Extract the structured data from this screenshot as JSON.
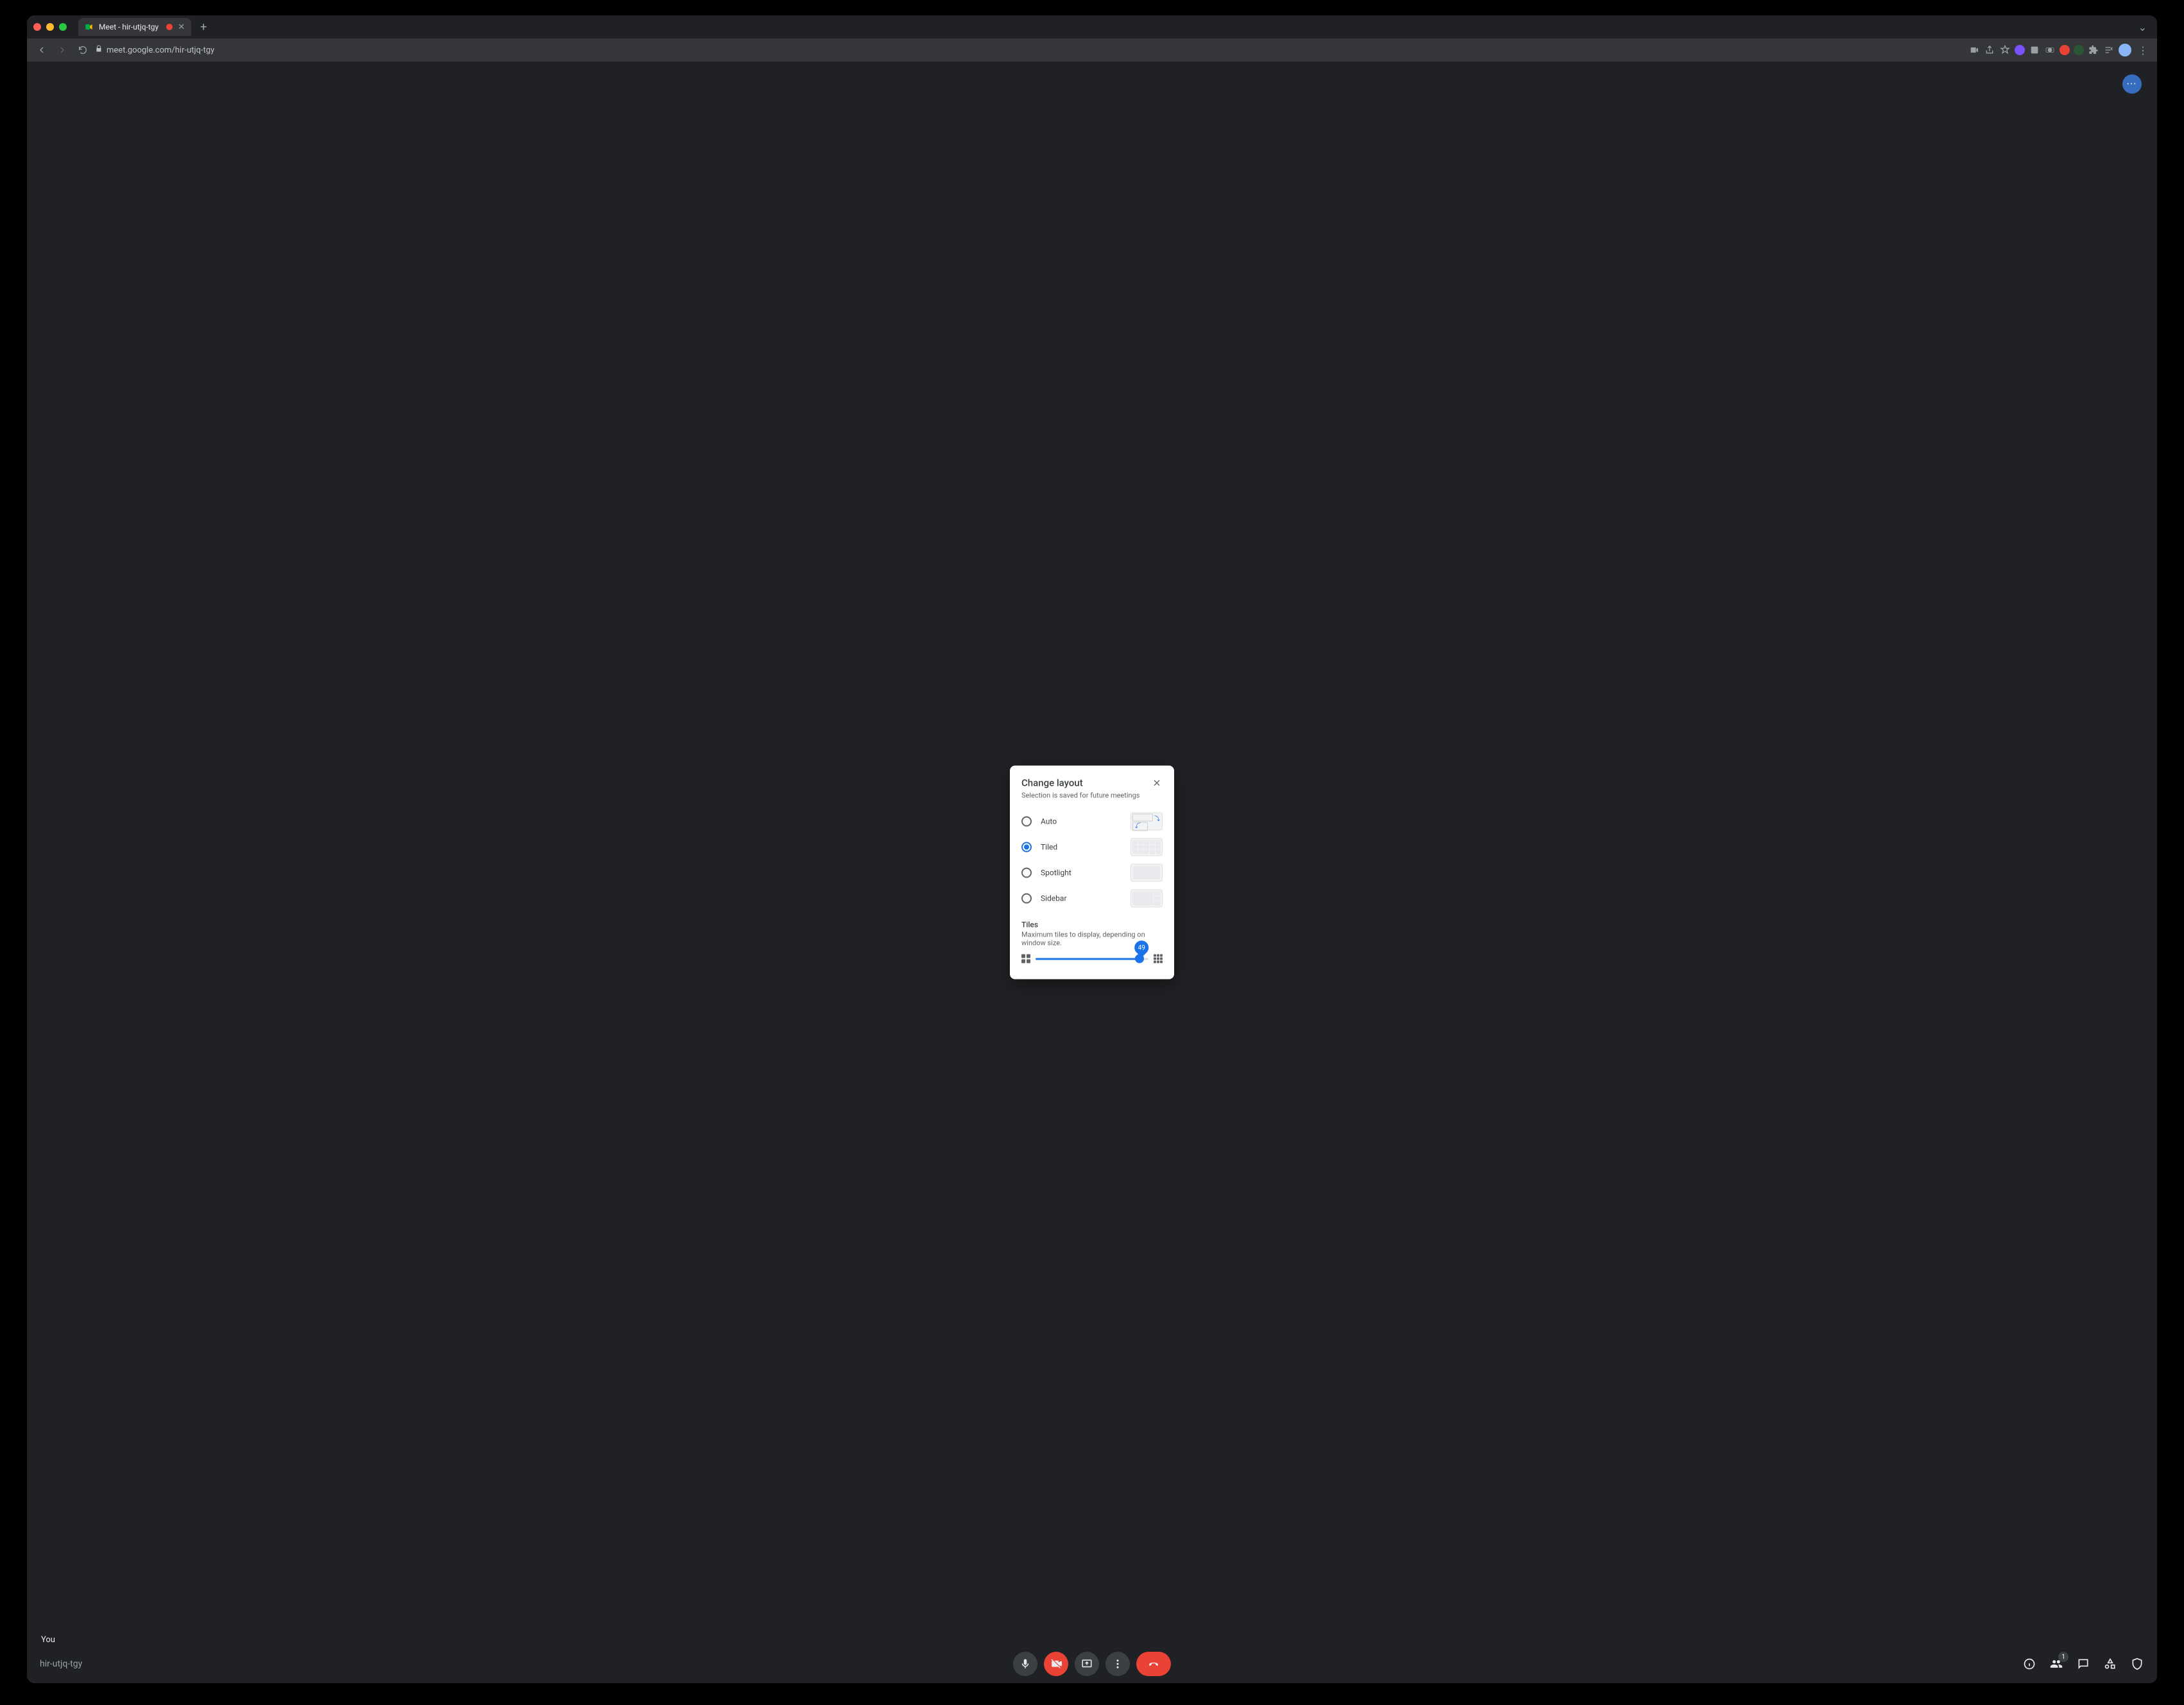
{
  "browser": {
    "tab_title": "Meet - hir-utjq-tgy",
    "url": "meet.google.com/hir-utjq-tgy"
  },
  "meet": {
    "self_label": "You",
    "meeting_code": "hir-utjq-tgy",
    "participants_badge": "1"
  },
  "dialog": {
    "title": "Change layout",
    "subtitle": "Selection is saved for future meetings",
    "options": {
      "auto": "Auto",
      "tiled": "Tiled",
      "spotlight": "Spotlight",
      "sidebar": "Sidebar"
    },
    "selected": "tiled",
    "tiles_heading": "Tiles",
    "tiles_desc": "Maximum tiles to display, depending on window size.",
    "tiles_value": "49",
    "tiles_percent": 92
  }
}
